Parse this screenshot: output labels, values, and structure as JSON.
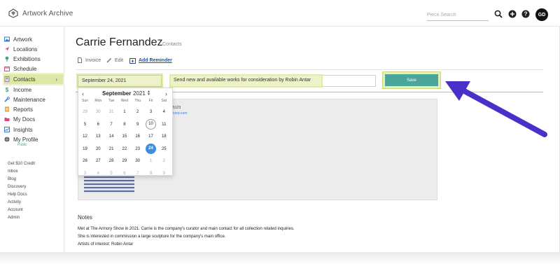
{
  "app": {
    "name": "Artwork Archive"
  },
  "topbar": {
    "search_placeholder": "Piece Search",
    "avatar_initials": "GD"
  },
  "sidebar": {
    "items": [
      {
        "label": "Artwork",
        "icon": "image-icon",
        "color": "#3a7bd5"
      },
      {
        "label": "Locations",
        "icon": "location-arrow-icon",
        "color": "#e0457b"
      },
      {
        "label": "Exhibitions",
        "icon": "pin-icon",
        "color": "#3aa57a"
      },
      {
        "label": "Schedule",
        "icon": "calendar-icon",
        "color": "#e0457b"
      },
      {
        "label": "Contacts",
        "icon": "contacts-icon",
        "color": "#8a7fd0"
      },
      {
        "label": "Income",
        "icon": "dollar-icon",
        "color": "#3aa57a"
      },
      {
        "label": "Maintenance",
        "icon": "wrench-icon",
        "color": "#4a6fd0"
      },
      {
        "label": "Reports",
        "icon": "report-icon",
        "color": "#e0a03a"
      },
      {
        "label": "My Docs",
        "icon": "folder-icon",
        "color": "#e0457b"
      },
      {
        "label": "Insights",
        "icon": "chart-icon",
        "color": "#3a7bd5"
      },
      {
        "label": "My Profile",
        "icon": "globe-icon",
        "color": "#555555"
      }
    ],
    "profile_sub": "Public",
    "links": [
      "Get $10 Credit",
      "Inbox",
      "Blog",
      "Discovery",
      "Help Docs",
      "Activity",
      "Account",
      "Admin"
    ]
  },
  "page": {
    "title": "Carrie Fernandez",
    "breadcrumb_sep": "/",
    "breadcrumb": "Contacts",
    "actions": {
      "invoice": "Invoice",
      "edit": "Edit",
      "add_reminder": "Add Reminder"
    }
  },
  "reminder": {
    "date_value": "September 24, 2021",
    "message_value": "Send new and available works for consideration by Robin Antar",
    "save_label": "Save"
  },
  "calendar": {
    "month": "September",
    "year": "2021",
    "weekdays": [
      "Sun",
      "Mon",
      "Tue",
      "Wed",
      "Thu",
      "Fri",
      "Sat"
    ],
    "weeks": [
      [
        "29",
        "30",
        "31",
        "1",
        "2",
        "3",
        "4"
      ],
      [
        "5",
        "6",
        "7",
        "8",
        "9",
        "10",
        "11"
      ],
      [
        "12",
        "13",
        "14",
        "15",
        "16",
        "17",
        "18"
      ],
      [
        "19",
        "20",
        "21",
        "22",
        "23",
        "24",
        "25"
      ],
      [
        "26",
        "27",
        "28",
        "29",
        "30",
        "1",
        "2"
      ],
      [
        "3",
        "4",
        "5",
        "6",
        "7",
        "8",
        "9"
      ]
    ],
    "today": "10",
    "selected": "24"
  },
  "card": {
    "line1": "5123",
    "line2": "mecorp.com"
  },
  "notes": {
    "heading": "Notes",
    "lines": [
      "Met at The Armory Show in 2021. Carrie is the company's curator and main contact for all collection related inquiries.",
      "She is interested in commission a large sculpture for the company's main office.",
      "Artists of interest: Robin Antar"
    ]
  },
  "colors": {
    "accent": "#4aa69a",
    "highlight": "#eef2c8",
    "arrow": "#4b2fc9",
    "selected_day": "#3d8de0"
  }
}
